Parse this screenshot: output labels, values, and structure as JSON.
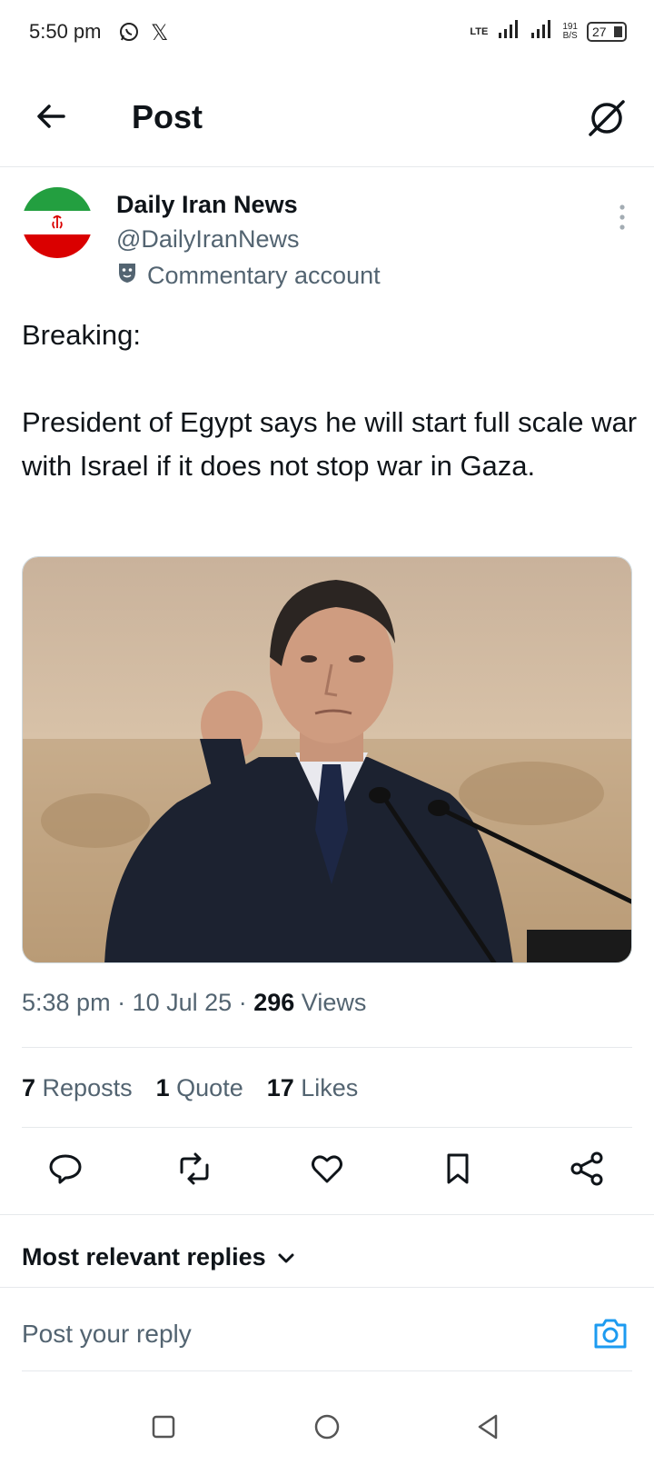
{
  "status_bar": {
    "time": "5:50 pm",
    "network": "LTE",
    "speed_value": "191",
    "speed_unit": "B/S",
    "battery": "27"
  },
  "header": {
    "title": "Post"
  },
  "post": {
    "author_name": "Daily Iran News",
    "author_handle": "@DailyIranNews",
    "account_label": "Commentary account",
    "text": "Breaking:\n\nPresident of Egypt says he will start full scale war with Israel if it does not stop war in Gaza.",
    "time": "5:38 pm",
    "date": "10 Jul 25",
    "views_count": "296",
    "views_label": "Views",
    "separator": "·"
  },
  "stats": {
    "reposts_count": "7",
    "reposts_label": "Reposts",
    "quotes_count": "1",
    "quotes_label": "Quote",
    "likes_count": "17",
    "likes_label": "Likes"
  },
  "replies": {
    "sort_label": "Most relevant replies",
    "reply_placeholder": "Post your reply"
  },
  "colors": {
    "text_primary": "#0f1419",
    "text_secondary": "#536471",
    "accent": "#1d9bf0",
    "divider": "#e6e9ec"
  }
}
